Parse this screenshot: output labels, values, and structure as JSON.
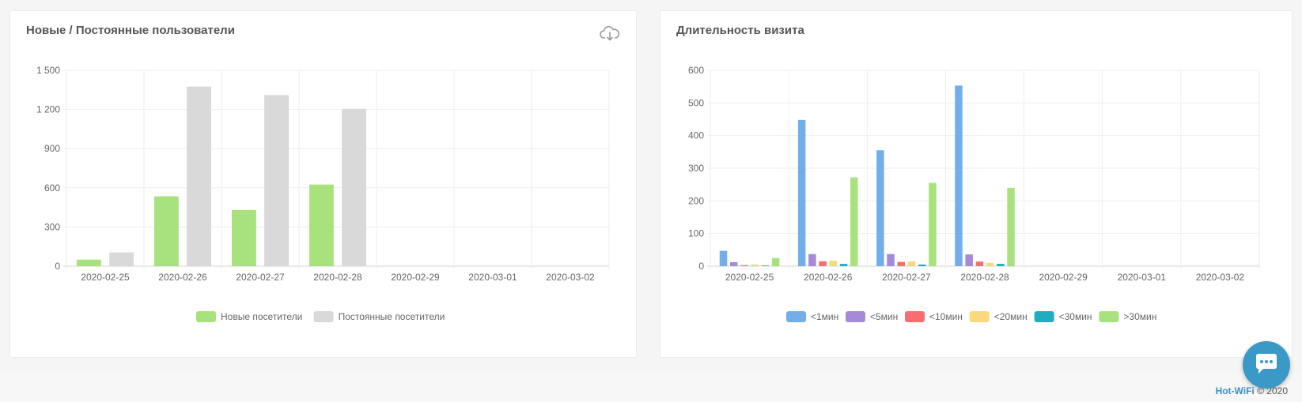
{
  "colors": {
    "new_visitors": "#a8e27d",
    "returning_visitors": "#d9d9d9",
    "lt1": "#74aee8",
    "lt5": "#a68ad8",
    "lt10": "#f86e6e",
    "lt20": "#fbd97b",
    "lt30": "#1eaec0",
    "gt30": "#a8e27d",
    "accent": "#3a99c7"
  },
  "icons": {
    "download": "cloud-download-icon",
    "chat": "chat-icon"
  },
  "chart_data": [
    {
      "type": "bar",
      "title": "Новые / Постоянные пользователи",
      "categories": [
        "2020-02-25",
        "2020-02-26",
        "2020-02-27",
        "2020-02-28",
        "2020-02-29",
        "2020-03-01",
        "2020-03-02"
      ],
      "ylim": [
        0,
        1500
      ],
      "yticks": [
        0,
        300,
        600,
        900,
        1200,
        1500
      ],
      "ytick_labels": [
        "0",
        "300",
        "600",
        "900",
        "1 200",
        "1 500"
      ],
      "grid": true,
      "legend_position": "bottom",
      "series": [
        {
          "name": "Новые посетители",
          "color": "#a8e27d",
          "values": [
            50,
            535,
            430,
            625,
            0,
            0,
            0
          ]
        },
        {
          "name": "Постоянные посетители",
          "color": "#d9d9d9",
          "values": [
            105,
            1375,
            1310,
            1205,
            0,
            0,
            0
          ]
        }
      ]
    },
    {
      "type": "bar",
      "title": "Длительность визита",
      "categories": [
        "2020-02-25",
        "2020-02-26",
        "2020-02-27",
        "2020-02-28",
        "2020-02-29",
        "2020-03-01",
        "2020-03-02"
      ],
      "ylim": [
        0,
        600
      ],
      "yticks": [
        0,
        100,
        200,
        300,
        400,
        500,
        600
      ],
      "ytick_labels": [
        "0",
        "100",
        "200",
        "300",
        "400",
        "500",
        "600"
      ],
      "grid": true,
      "legend_position": "bottom",
      "series": [
        {
          "name": "<1мин",
          "color": "#74aee8",
          "values": [
            47,
            448,
            355,
            553,
            0,
            0,
            0
          ]
        },
        {
          "name": "<5мин",
          "color": "#a68ad8",
          "values": [
            12,
            37,
            37,
            36,
            0,
            0,
            0
          ]
        },
        {
          "name": "<10мин",
          "color": "#f86e6e",
          "values": [
            3,
            15,
            13,
            14,
            0,
            0,
            0
          ]
        },
        {
          "name": "<20мин",
          "color": "#fbd97b",
          "values": [
            5,
            17,
            15,
            10,
            0,
            0,
            0
          ]
        },
        {
          "name": "<30мин",
          "color": "#1eaec0",
          "values": [
            2,
            7,
            5,
            7,
            0,
            0,
            0
          ]
        },
        {
          "name": ">30мин",
          "color": "#a8e27d",
          "values": [
            25,
            272,
            255,
            240,
            0,
            0,
            0
          ]
        }
      ]
    }
  ],
  "footer": {
    "brand": "Hot-WiFi",
    "copyright": "© 2020"
  }
}
